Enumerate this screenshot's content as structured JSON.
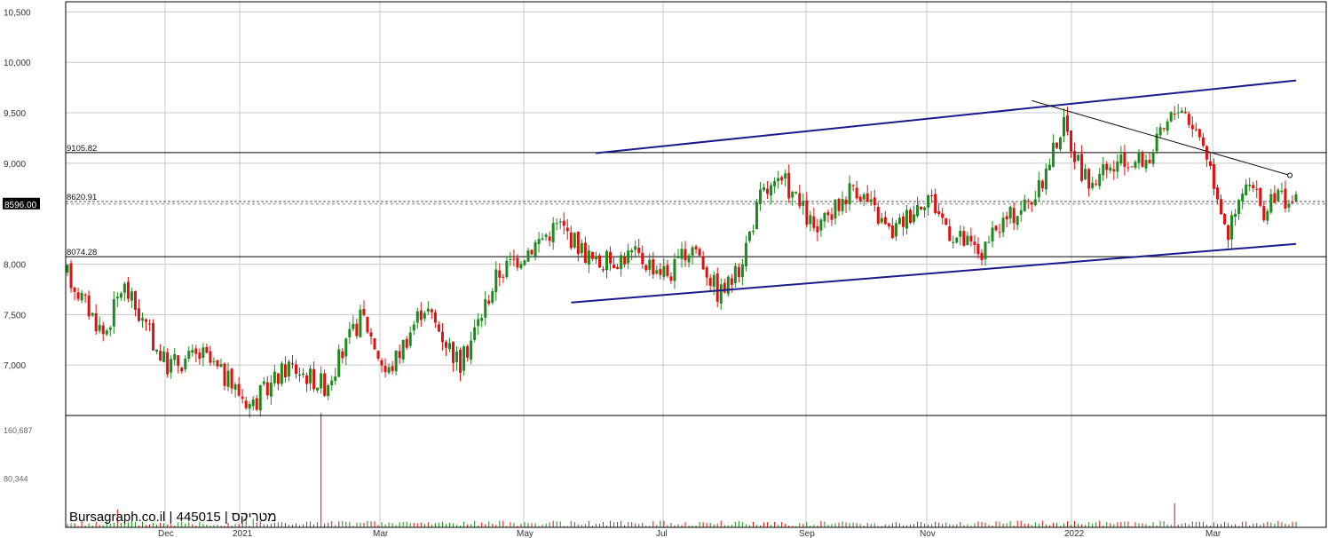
{
  "watermark": "Bursagraph.co.il | 445015 | מטריקס",
  "colors": {
    "up": "#1c8a1c",
    "down": "#e01010",
    "trend": "#1a1a8c",
    "grid": "#c8c8c8"
  },
  "chart_data": {
    "type": "candlestick",
    "title": "",
    "y_range": [
      6500,
      10600
    ],
    "y_ticks": [
      {
        "value": 10500,
        "label": "10,500"
      },
      {
        "value": 10000,
        "label": "10,000"
      },
      {
        "value": 9500,
        "label": "9,500"
      },
      {
        "value": 9000,
        "label": "9,000"
      },
      {
        "value": 8000,
        "label": "8,000"
      },
      {
        "value": 7500,
        "label": "7,500"
      },
      {
        "value": 7000,
        "label": "7,000"
      }
    ],
    "x_ticks": [
      "Dec",
      "2021",
      "Mar",
      "May",
      "Jul",
      "Sep",
      "Nov",
      "2022",
      "Mar"
    ],
    "last_price": {
      "value": 8596.0,
      "label": "8596.00"
    },
    "levels": [
      {
        "value": 9105.82,
        "label": "9105.82"
      },
      {
        "value": 8620.91,
        "label": "8620.91"
      },
      {
        "value": 8074.28,
        "label": "8074.28"
      }
    ],
    "trendlines": [
      {
        "name": "channel-top",
        "from": [
          0.43,
          9100
        ],
        "to": [
          1.0,
          9820
        ]
      },
      {
        "name": "channel-bottom",
        "from": [
          0.41,
          7620
        ],
        "to": [
          1.0,
          8200
        ]
      },
      {
        "name": "decline-line",
        "from": [
          0.785,
          9620
        ],
        "to": [
          0.995,
          8880
        ]
      }
    ],
    "path_points": [
      [
        0.0,
        7900
      ],
      [
        0.03,
        7300
      ],
      [
        0.045,
        7800
      ],
      [
        0.08,
        7000
      ],
      [
        0.11,
        7100
      ],
      [
        0.15,
        6600
      ],
      [
        0.18,
        7000
      ],
      [
        0.21,
        6800
      ],
      [
        0.24,
        7500
      ],
      [
        0.26,
        6900
      ],
      [
        0.29,
        7600
      ],
      [
        0.32,
        7000
      ],
      [
        0.35,
        7900
      ],
      [
        0.38,
        8200
      ],
      [
        0.4,
        8400
      ],
      [
        0.43,
        8000
      ],
      [
        0.46,
        8100
      ],
      [
        0.49,
        7900
      ],
      [
        0.51,
        8200
      ],
      [
        0.53,
        7700
      ],
      [
        0.545,
        7900
      ],
      [
        0.565,
        8700
      ],
      [
        0.585,
        8800
      ],
      [
        0.61,
        8300
      ],
      [
        0.64,
        8800
      ],
      [
        0.67,
        8300
      ],
      [
        0.7,
        8700
      ],
      [
        0.72,
        8300
      ],
      [
        0.745,
        8100
      ],
      [
        0.76,
        8400
      ],
      [
        0.79,
        8700
      ],
      [
        0.81,
        9400
      ],
      [
        0.83,
        8800
      ],
      [
        0.86,
        9000
      ],
      [
        0.88,
        9050
      ],
      [
        0.905,
        9600
      ],
      [
        0.925,
        9200
      ],
      [
        0.945,
        8300
      ],
      [
        0.96,
        8800
      ],
      [
        0.975,
        8500
      ],
      [
        0.985,
        8700
      ],
      [
        1.0,
        8600
      ]
    ],
    "volume": {
      "y_ticks": [
        {
          "value": 160687,
          "label": "160,687"
        },
        {
          "value": 80344,
          "label": "80,344"
        }
      ],
      "max": 180000,
      "spikes": [
        {
          "at": 0.04,
          "value": 30000
        },
        {
          "at": 0.145,
          "value": 22000
        },
        {
          "at": 0.152,
          "value": 14000
        },
        {
          "at": 0.205,
          "value": 190000
        },
        {
          "at": 0.9,
          "value": 40000
        }
      ]
    }
  }
}
